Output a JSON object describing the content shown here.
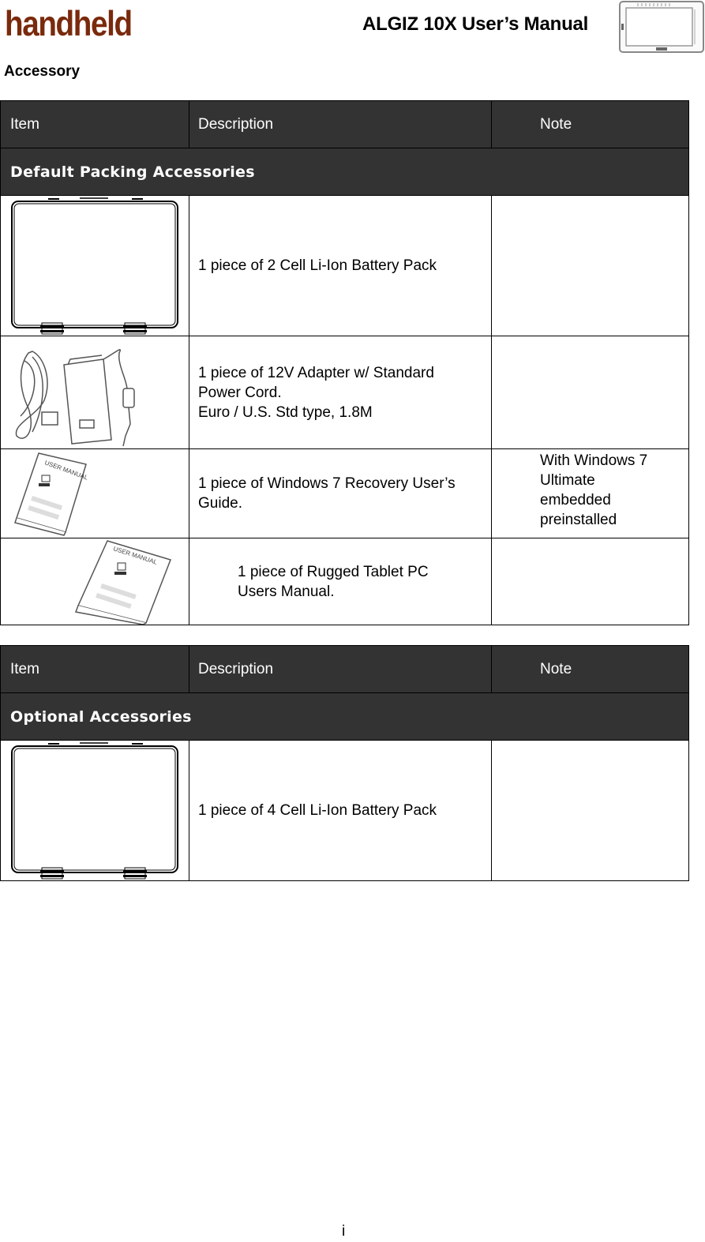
{
  "header": {
    "brand": "handheld",
    "brand_color": "#7a2a0c",
    "doc_title": "ALGIZ 10X User’s Manual",
    "device_thumbnail": "tablet-device-icon"
  },
  "section_title": "Accessory",
  "tables": [
    {
      "columns": [
        "Item",
        "Description",
        "Note"
      ],
      "group_label": "Default Packing Accessories",
      "rows": [
        {
          "image": "battery-pack-icon",
          "description": "1 piece of 2 Cell Li-Ion Battery Pack",
          "note": ""
        },
        {
          "image": "power-adapter-icon",
          "description_lines": [
            "1 piece of 12V Adapter w/ Standard",
            "Power Cord.",
            "Euro / U.S. Std type, 1.8M"
          ],
          "note": ""
        },
        {
          "image": "user-manual-icon",
          "description": "1 piece of Windows 7 Recovery User’s Guide.",
          "note_lines": [
            "With Windows 7",
            "Ultimate",
            "embedded",
            "preinstalled"
          ]
        },
        {
          "image": "user-manual-icon",
          "description_lines": [
            "1 piece of Rugged Tablet PC",
            "Users Manual."
          ],
          "note": ""
        }
      ]
    },
    {
      "columns": [
        "Item",
        "Description",
        "Note"
      ],
      "group_label": "Optional Accessories",
      "rows": [
        {
          "image": "battery-pack-icon",
          "description": "1 piece of 4 Cell Li-Ion Battery Pack",
          "note": ""
        }
      ]
    }
  ],
  "colors": {
    "header_bg": "#333333",
    "header_text": "#ffffff"
  },
  "footer": {
    "page_number": "i"
  }
}
